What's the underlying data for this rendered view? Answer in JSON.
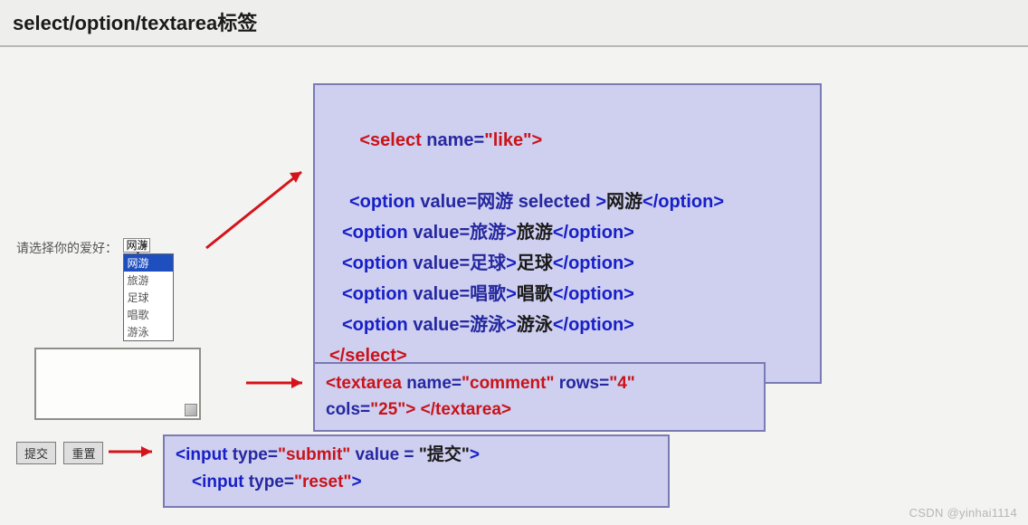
{
  "title": "select/option/textarea标签",
  "form": {
    "label": "请选择你的爱好：",
    "selected_value": "网游",
    "options": [
      "网游",
      "旅游",
      "足球",
      "唱歌",
      "游泳"
    ]
  },
  "buttons": {
    "submit": "提交",
    "reset": "重置"
  },
  "code": {
    "select_open": "<select",
    "name_attr": " name=",
    "select_name_val": "\"like\"",
    "close_gt": ">",
    "option_open": "<option",
    "value_attr": " value=",
    "opt_selected": " selected ",
    "vals": {
      "v1": "网游",
      "v2": "旅游",
      "v3": "足球",
      "v4": "唱歌",
      "v5": "游泳"
    },
    "option_close": "</option>",
    "select_close": "</select>",
    "textarea_line1a": "<textarea",
    "textarea_name": "  name=",
    "textarea_name_val": "\"comment\"",
    "textarea_rows": " rows=",
    "textarea_rows_val": "\"4\"",
    "textarea_cols": "cols=",
    "textarea_cols_val": "\"25\"",
    "textarea_line2_close": "> ",
    "textarea_close": "</textarea>",
    "input_open": "<input",
    "type_attr": " type=",
    "submit_val": "\"submit\"",
    "value_attr2": " value = ",
    "submit_label_val": "\"提交\"",
    "reset_val": "\"reset\"",
    "gt": ">"
  },
  "watermark": "CSDN @yinhai1114"
}
